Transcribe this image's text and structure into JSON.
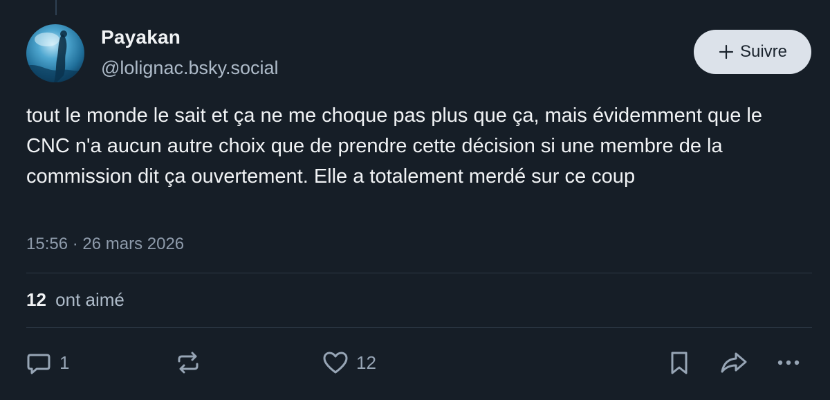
{
  "author": {
    "display_name": "Payakan",
    "handle": "@lolignac.bsky.social"
  },
  "follow_button": {
    "label": "Suivre"
  },
  "post": {
    "text": "tout le monde le sait et ça ne me choque pas plus que ça, mais évidemment que le CNC n'a aucun autre choix que de prendre cette décision si une membre de la commission dit ça ouvertement. Elle a totalement merdé sur ce coup",
    "timestamp": "15:56 · 26 mars 2026"
  },
  "likes_summary": {
    "count": "12",
    "label": "ont aimé"
  },
  "actions": {
    "reply_count": "1",
    "repost_count": "",
    "like_count": "12"
  },
  "icons": {
    "reply": "reply-icon",
    "repost": "repost-icon",
    "like": "heart-icon",
    "bookmark": "bookmark-icon",
    "share": "share-icon",
    "more": "more-icon",
    "follow": "plus-icon"
  },
  "colors": {
    "background": "#161e27",
    "text": "#f1f3f5",
    "muted": "#8e9bab",
    "button_bg": "#dce2ea",
    "divider": "#2e3a47"
  }
}
